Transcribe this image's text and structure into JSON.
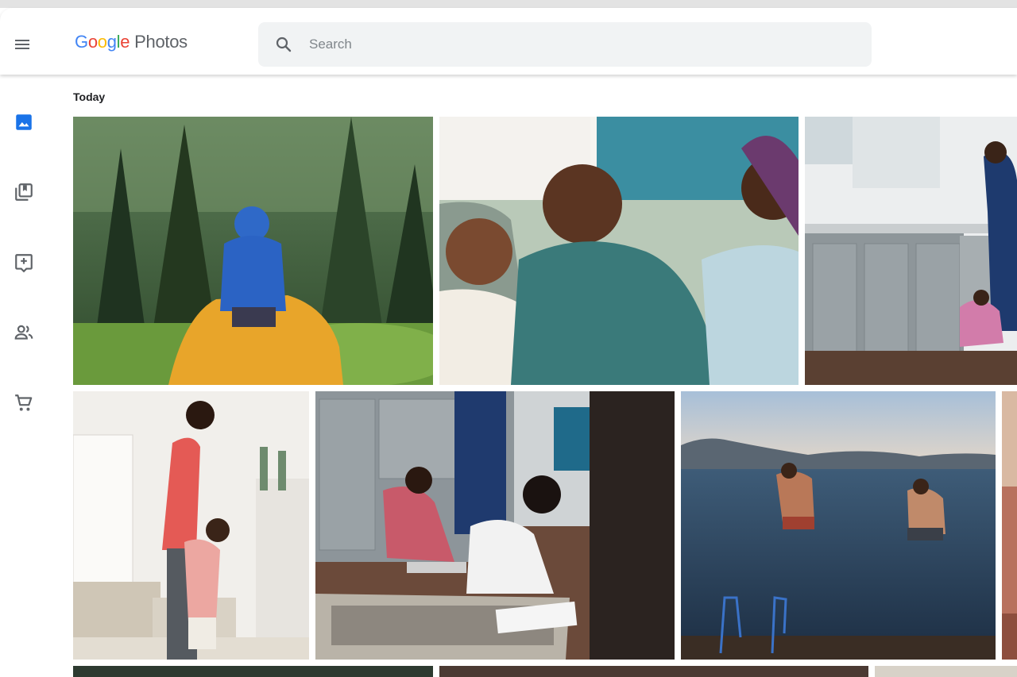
{
  "app": {
    "logo_letters": [
      "G",
      "o",
      "o",
      "g",
      "l",
      "e"
    ],
    "logo_product": "Photos",
    "colors": {
      "blue": "#4285f4",
      "red": "#ea4335",
      "yellow": "#fbbc05",
      "green": "#34a853",
      "nav_active": "#1a73e8",
      "nav_icon": "#5f6368"
    }
  },
  "header": {
    "menu_icon": "hamburger-menu-icon",
    "search": {
      "icon": "search-icon",
      "placeholder": "Search",
      "value": ""
    }
  },
  "sidebar": {
    "items": [
      {
        "name": "photos",
        "icon": "photo-icon",
        "active": true
      },
      {
        "name": "albums",
        "icon": "album-icon",
        "active": false
      },
      {
        "name": "for-you",
        "icon": "assistant-icon",
        "active": false
      },
      {
        "name": "sharing",
        "icon": "people-icon",
        "active": false
      },
      {
        "name": "print-store",
        "icon": "cart-icon",
        "active": false
      }
    ]
  },
  "library": {
    "section_label": "Today",
    "photos": [
      {
        "subject": "child on shoulders in forest"
      },
      {
        "subject": "women laughing on couch"
      },
      {
        "subject": "kitchen with man and child"
      },
      {
        "subject": "mother and daughter in living room"
      },
      {
        "subject": "children playing on kitchen floor"
      },
      {
        "subject": "boys jumping into lake"
      }
    ]
  }
}
